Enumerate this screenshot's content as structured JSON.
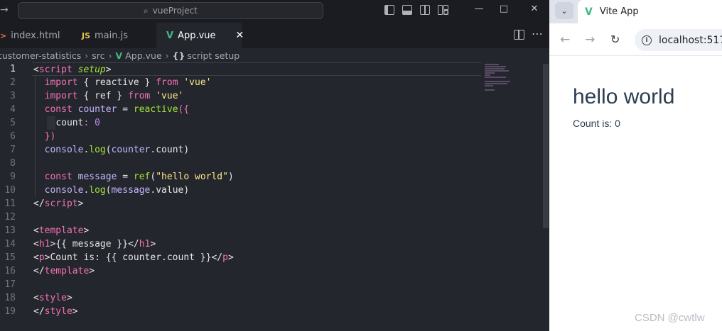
{
  "vscode": {
    "command_center": "vueProject",
    "tabs": [
      {
        "label": "index.html",
        "icon": ">"
      },
      {
        "label": "main.js",
        "icon": "JS"
      },
      {
        "label": "App.vue",
        "icon": "V",
        "active": true
      }
    ],
    "breadcrumb": [
      "customer-statistics",
      "src",
      "App.vue",
      "script setup"
    ],
    "line_numbers": [
      "1",
      "2",
      "3",
      "4",
      "5",
      "6",
      "7",
      "8",
      "9",
      "10",
      "11",
      "12",
      "13",
      "14",
      "15",
      "16",
      "17",
      "18",
      "19"
    ],
    "code": {
      "l1": {
        "open": "<",
        "tag": "script",
        "attr": "setup",
        "close": ">"
      },
      "l2": {
        "kw1": "import",
        "p1": " { ",
        "name": "reactive",
        "p2": " } ",
        "kw2": "from",
        "str": "'vue'"
      },
      "l3": {
        "kw1": "import",
        "p1": " { ",
        "name": "ref",
        "p2": " } ",
        "kw2": "from",
        "str": "'vue'"
      },
      "l4": {
        "kw": "const",
        "var": "counter",
        "eq": " = ",
        "fn": "reactive",
        "p": "({"
      },
      "l5": {
        "prop": "count",
        "colon": ": ",
        "num": "0"
      },
      "l6": {
        "p": "})"
      },
      "l7": {
        "obj": "console",
        "dot": ".",
        "fn": "log",
        "p1": "(",
        "var": "counter",
        "dot2": ".",
        "prop": "count",
        "p2": ")"
      },
      "l9": {
        "kw": "const",
        "var": "message",
        "eq": " = ",
        "fn": "ref",
        "p1": "(",
        "str": "\"hello world\"",
        "p2": ")"
      },
      "l10": {
        "obj": "console",
        "dot": ".",
        "fn": "log",
        "p1": "(",
        "var": "message",
        "dot2": ".",
        "prop": "value",
        "p2": ")"
      },
      "l11": {
        "open": "</",
        "tag": "script",
        "close": ">"
      },
      "l13": {
        "open": "<",
        "tag": "template",
        "close": ">"
      },
      "l14": {
        "open": "<",
        "tag": "h1",
        "close": ">",
        "text": "{{ message }}",
        "end_open": "</",
        "end_tag": "h1",
        "end_close": ">"
      },
      "l15": {
        "open": "<",
        "tag": "p",
        "close": ">",
        "text": "Count is: {{ counter.count }}",
        "end_open": "</",
        "end_tag": "p",
        "end_close": ">"
      },
      "l16": {
        "open": "</",
        "tag": "template",
        "close": ">"
      },
      "l18": {
        "open": "<",
        "tag": "style",
        "close": ">"
      },
      "l19": {
        "open": "</",
        "tag": "style",
        "close": ">"
      }
    }
  },
  "browser": {
    "tab_title": "Vite App",
    "address": "localhost:517",
    "page": {
      "heading": "hello world",
      "count_text": "Count is: 0"
    },
    "watermark": "CSDN @cwtlw"
  },
  "colors": {
    "vue_green": "#41b883",
    "editor_bg": "#24262d",
    "tag_pink": "#f472b6",
    "string_yellow": "#fde68a",
    "var_purple": "#c4b5fd",
    "fn_green": "#a3e635"
  }
}
